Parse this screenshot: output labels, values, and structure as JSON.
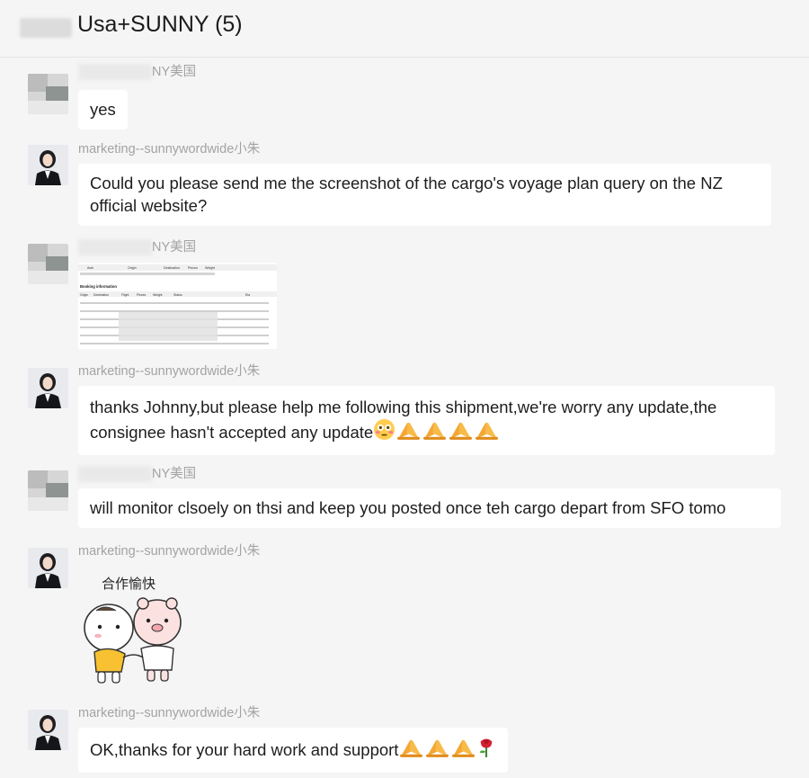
{
  "header": {
    "title": "Usa+SUNNY (5)"
  },
  "messages": [
    {
      "sender": "NY美国",
      "text": "yes"
    },
    {
      "sender": "marketing--sunnywordwide小朱",
      "text": "Could you please send me the screenshot of the cargo's voyage plan query on the NZ official website?"
    },
    {
      "sender": "NY美国"
    },
    {
      "sender": "marketing--sunnywordwide小朱",
      "text": "thanks Johnny,but please help me following this shipment,we're worry any update,the consignee hasn't   accepted any update"
    },
    {
      "sender": "NY美国",
      "text": "will monitor clsoely on thsi and keep you posted once teh cargo depart from SFO tomo"
    },
    {
      "sender": "marketing--sunnywordwide小朱"
    },
    {
      "sender": "marketing--sunnywordwide小朱",
      "text": "OK,thanks for your hard work and support"
    }
  ],
  "shared_image": {
    "col1": "Awb",
    "col2": "Origin",
    "col3": "Destination",
    "col4": "Pieces",
    "col5": "Weight",
    "section": "Booking information",
    "col_b": [
      "Origin",
      "Destination",
      "Flight",
      "Pieces",
      "Weight",
      "Status",
      "Eta"
    ]
  },
  "sticker": {
    "caption": "合作愉快"
  },
  "icons": {
    "emoji_flushed": "flushed-face-emoji",
    "emoji_pray": "folded-hands-emoji",
    "emoji_rose": "rose-emoji"
  }
}
